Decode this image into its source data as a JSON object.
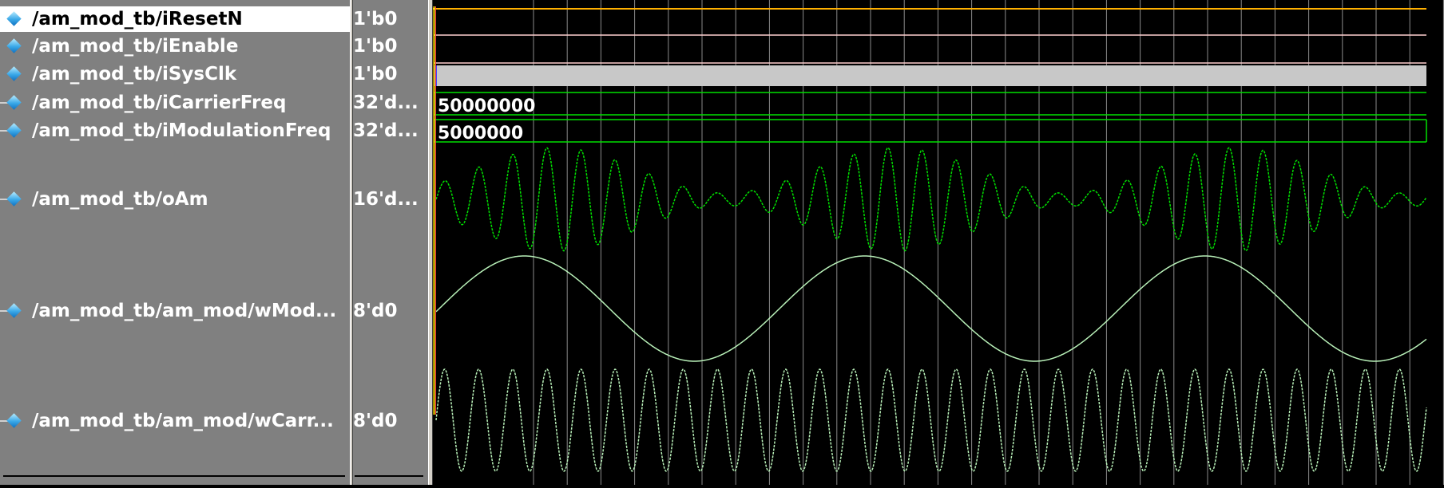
{
  "signals": [
    {
      "name": "/am_mod_tb/iResetN",
      "value": "1'b0",
      "expandable": false,
      "selected": true
    },
    {
      "name": "/am_mod_tb/iEnable",
      "value": "1'b0",
      "expandable": false,
      "selected": false
    },
    {
      "name": "/am_mod_tb/iSysClk",
      "value": "1'b0",
      "expandable": false,
      "selected": false
    },
    {
      "name": "/am_mod_tb/iCarrierFreq",
      "value": "32'd...",
      "expandable": true,
      "selected": false
    },
    {
      "name": "/am_mod_tb/iModulationFreq",
      "value": "32'd...",
      "expandable": true,
      "selected": false
    },
    {
      "name": "/am_mod_tb/oAm",
      "value": "16'd...",
      "expandable": true,
      "selected": false
    },
    {
      "name": "/am_mod_tb/am_mod/wMod...",
      "value": "8'd0",
      "expandable": true,
      "selected": false
    },
    {
      "name": "/am_mod_tb/am_mod/wCarr...",
      "value": "8'd0",
      "expandable": true,
      "selected": false
    }
  ],
  "bus_values": {
    "iCarrierFreq": "50000000",
    "iModulationFreq": "5000000"
  },
  "colors": {
    "pane_bg": "#808080",
    "wave_bg": "#000000",
    "wave_green": "#00e000",
    "wave_light_green": "#b8f0b8",
    "grid": "#8a8a8a",
    "clock_fill": "#c8c8c8",
    "cursor": "#ffe000",
    "icon_blue": "#3aa8e8"
  }
}
